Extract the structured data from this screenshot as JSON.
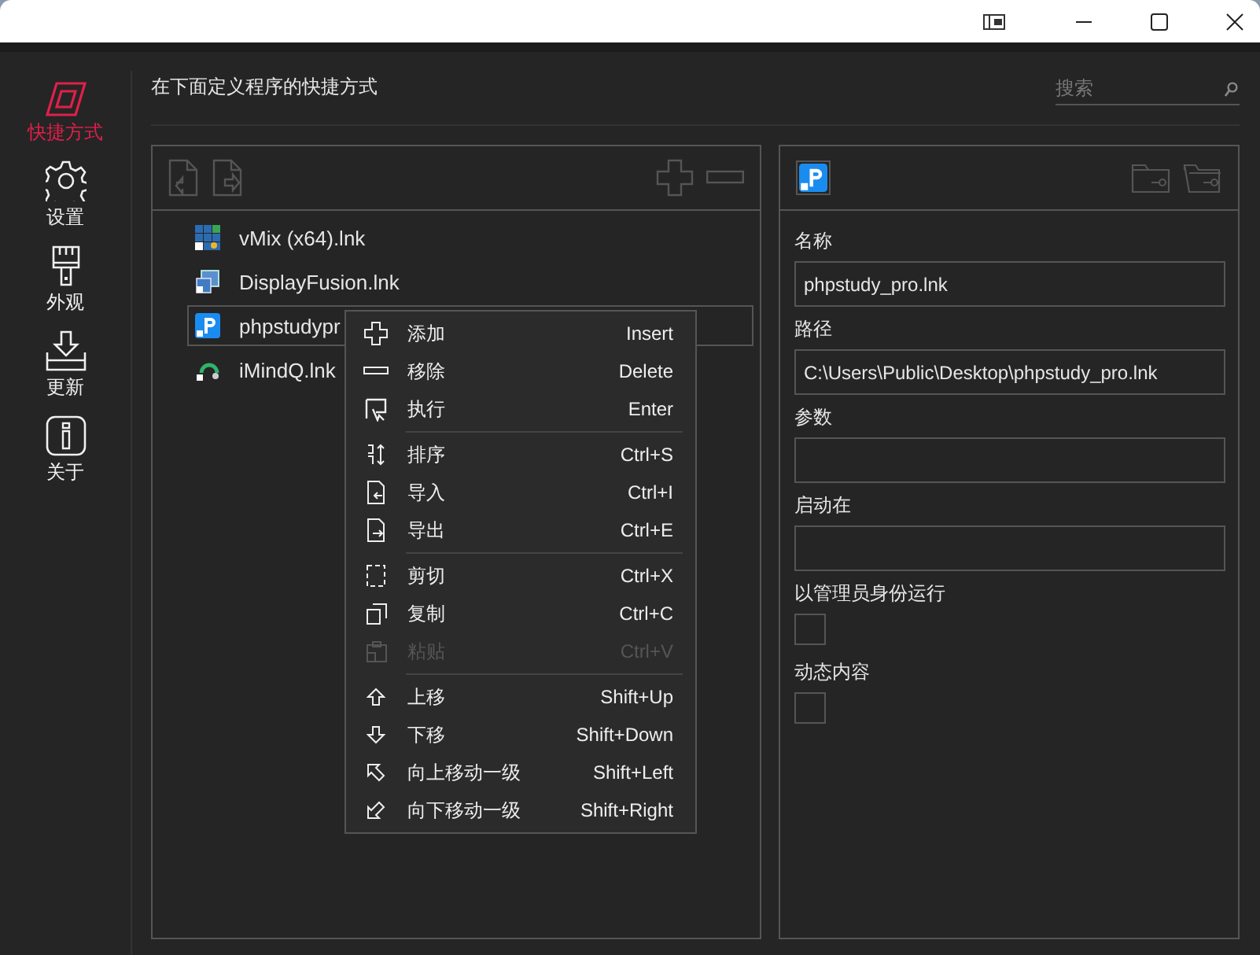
{
  "sidebar": {
    "items": [
      {
        "label": "快捷方式",
        "kind": "shortcut",
        "selected": true
      },
      {
        "label": "设置",
        "kind": "settings",
        "selected": false
      },
      {
        "label": "外观",
        "kind": "appearance",
        "selected": false
      },
      {
        "label": "更新",
        "kind": "update",
        "selected": false
      },
      {
        "label": "关于",
        "kind": "about",
        "selected": false
      }
    ]
  },
  "header": {
    "title": "在下面定义程序的快捷方式",
    "search": {
      "placeholder": "搜索"
    }
  },
  "shortcut_list": {
    "items": [
      {
        "name": "vMix (x64).lnk",
        "kind": "grid",
        "selected": false
      },
      {
        "name": "DisplayFusion.lnk",
        "kind": "monitor",
        "selected": false
      },
      {
        "name": "phpstudypr",
        "kind": "letter",
        "selected": true
      },
      {
        "name": "iMindQ.lnk",
        "kind": "ring",
        "selected": false
      }
    ]
  },
  "context_menu": {
    "groups": [
      [
        {
          "label": "添加",
          "shortcut": "Insert",
          "kind": "plus",
          "disabled": false
        },
        {
          "label": "移除",
          "shortcut": "Delete",
          "kind": "minus",
          "disabled": false
        },
        {
          "label": "执行",
          "shortcut": "Enter",
          "kind": "run",
          "disabled": false
        }
      ],
      [
        {
          "label": "排序",
          "shortcut": "Ctrl+S",
          "kind": "sort",
          "disabled": false
        },
        {
          "label": "导入",
          "shortcut": "Ctrl+I",
          "kind": "import",
          "disabled": false
        },
        {
          "label": "导出",
          "shortcut": "Ctrl+E",
          "kind": "export",
          "disabled": false
        }
      ],
      [
        {
          "label": "剪切",
          "shortcut": "Ctrl+X",
          "kind": "cut",
          "disabled": false
        },
        {
          "label": "复制",
          "shortcut": "Ctrl+C",
          "kind": "copy",
          "disabled": false
        },
        {
          "label": "粘贴",
          "shortcut": "Ctrl+V",
          "kind": "paste",
          "disabled": true
        }
      ],
      [
        {
          "label": "上移",
          "shortcut": "Shift+Up",
          "kind": "up",
          "disabled": false
        },
        {
          "label": "下移",
          "shortcut": "Shift+Down",
          "kind": "down",
          "disabled": false
        },
        {
          "label": "向上移动一级",
          "shortcut": "Shift+Left",
          "kind": "upleft",
          "disabled": false
        },
        {
          "label": "向下移动一级",
          "shortcut": "Shift+Right",
          "kind": "downleft",
          "disabled": false
        }
      ]
    ]
  },
  "details": {
    "fields": [
      {
        "label": "名称",
        "value": "phpstudy_pro.lnk"
      },
      {
        "label": "路径",
        "value": "C:\\Users\\Public\\Desktop\\phpstudy_pro.lnk"
      },
      {
        "label": "参数"
      },
      {
        "label": "启动在"
      }
    ],
    "options": [
      {
        "label": "以管理员身份运行",
        "checked": false
      },
      {
        "label": "动态内容",
        "checked": false
      }
    ]
  }
}
